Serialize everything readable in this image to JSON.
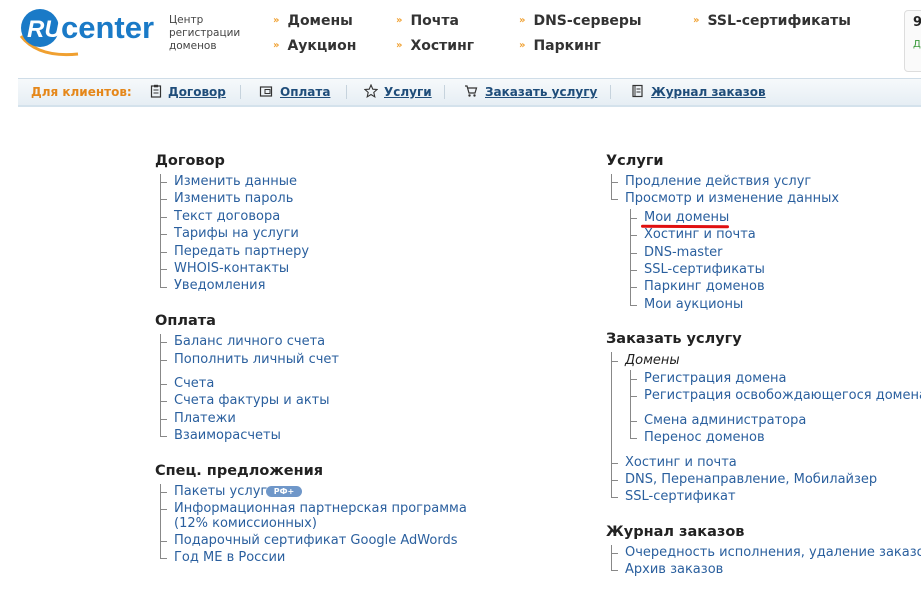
{
  "logo": {
    "brand_ru": "RU",
    "brand_center": "center"
  },
  "tagline": [
    "Центр",
    "регистрации",
    "доменов"
  ],
  "topnav": [
    "Домены",
    "Аукцион",
    "Почта",
    "Хостинг",
    "DNS-серверы",
    "Паркинг",
    "SSL-сертификаты"
  ],
  "promo": {
    "number": "9",
    "sub": "До"
  },
  "clientbar": {
    "title": "Для клиентов:",
    "items": [
      "Договор",
      "Оплата",
      "Услуги",
      "Заказать услугу",
      "Журнал заказов"
    ]
  },
  "contract": {
    "title": "Договор",
    "links": [
      "Изменить данные",
      "Изменить пароль",
      "Текст договора",
      "Тарифы на услуги",
      "Передать партнеру",
      "WHOIS-контакты",
      "Уведомления"
    ]
  },
  "payment": {
    "title": "Оплата",
    "links": [
      "Баланс личного счета",
      "Пополнить личный счет",
      "Счета",
      "Счета фактуры и акты",
      "Платежи",
      "Взаиморасчеты"
    ]
  },
  "special": {
    "title": "Спец. предложения",
    "links": [
      "Пакеты услуг",
      "Информационная партнерская программа",
      "(12% комиссионных)",
      "Подарочный сертификат Google AdWords",
      "Год МЕ в России"
    ],
    "badge": "РФ+"
  },
  "services": {
    "title": "Услуги",
    "links": [
      "Продление действия услуг",
      "Просмотр и изменение данных"
    ],
    "sublinks": [
      "Мои домены",
      "Хостинг и почта",
      "DNS-master",
      "SSL-сертификаты",
      "Паркинг доменов",
      "Мои аукционы"
    ]
  },
  "order": {
    "title": "Заказать услугу",
    "group_label": "Домены",
    "domain_links": [
      "Регистрация домена",
      "Регистрация освобождающегося домена",
      "Смена администратора",
      "Перенос доменов"
    ],
    "links": [
      "Хостинг и почта",
      "DNS, Перенаправление, Мобилайзер",
      "SSL-сертификат"
    ]
  },
  "journal": {
    "title": "Журнал заказов",
    "links": [
      "Очередность исполнения, удаление заказов",
      "Архив заказов"
    ]
  },
  "colors": {
    "link": "#2a5f9e",
    "accent": "#e5871a",
    "logo_blue": "#1a7ac7",
    "highlight": "#e01010"
  }
}
